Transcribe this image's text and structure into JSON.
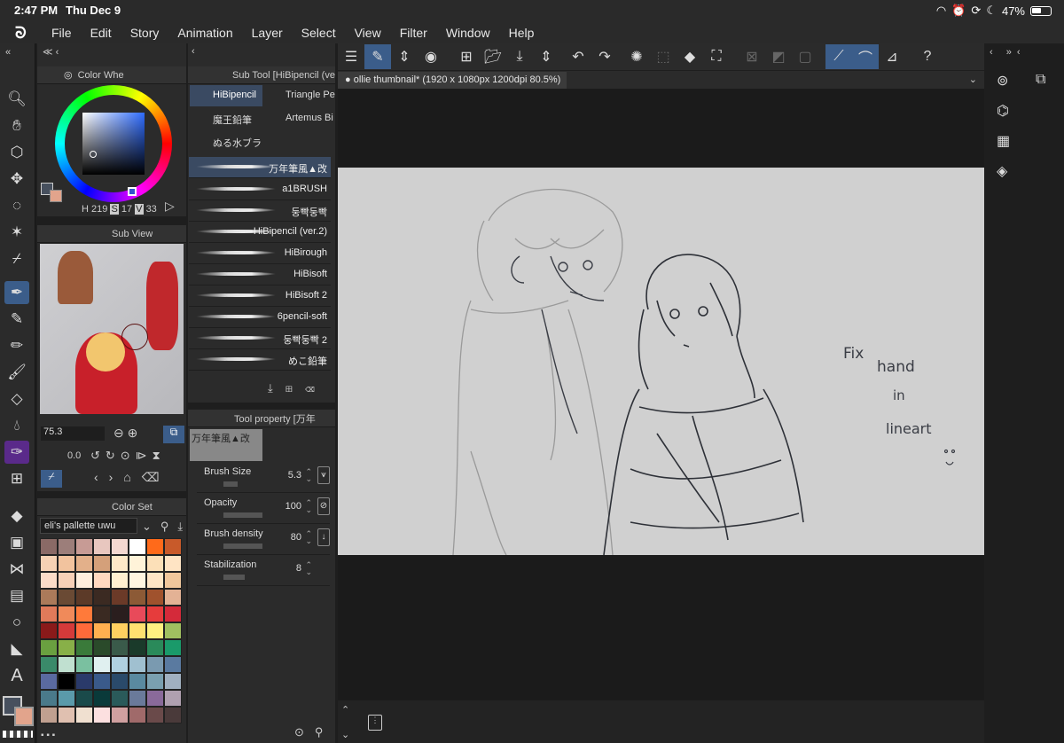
{
  "status": {
    "time": "2:47 PM",
    "date": "Thu Dec 9",
    "battery": "47%"
  },
  "menu": [
    "File",
    "Edit",
    "Story",
    "Animation",
    "Layer",
    "Select",
    "View",
    "Filter",
    "Window",
    "Help"
  ],
  "color_wheel": {
    "title": "Color Whe",
    "h_label": "H",
    "h": "219",
    "s_label": "S",
    "s": "17",
    "v_label": "V",
    "v": "33",
    "main_color": "#47505e",
    "sub_color": "#e2a48c"
  },
  "subview": {
    "title": "Sub View",
    "zoom": "75.3",
    "angle": "0.0"
  },
  "color_set": {
    "title": "Color Set",
    "palette": "eli's pallette uwu",
    "swatches": [
      "#8a6a66",
      "#9c7e7a",
      "#c79b95",
      "#e8c7bf",
      "#f4d8d0",
      "#ffffff",
      "#ff6a1a",
      "#c85a2a",
      "#f6d2b4",
      "#f2c39e",
      "#e3b08a",
      "#d4a07a",
      "#ffe9c8",
      "#fff3d9",
      "#fce0b8",
      "#ffe4c4",
      "#fcdcc8",
      "#f7d0b7",
      "#ffeedd",
      "#ffd9c0",
      "#fff0d0",
      "#fff5e0",
      "#ffe6c6",
      "#f0c79c",
      "#ab7a5a",
      "#6a4a34",
      "#5c3a28",
      "#3b2a22",
      "#6b3a28",
      "#8c5a36",
      "#a0522d",
      "#e3b295",
      "#e07a5a",
      "#f08a5a",
      "#ff7a3a",
      "#3a2a22",
      "#2a1e1e",
      "#e84a5a",
      "#e63c3c",
      "#d42a3a",
      "#8a1a1a",
      "#d43a3a",
      "#ff6a3a",
      "#ffb050",
      "#ffd060",
      "#ffe070",
      "#fff080",
      "#a0c060",
      "#6aa040",
      "#88b048",
      "#3a7a3a",
      "#2a4a2a",
      "#3a5a4a",
      "#1a3a2a",
      "#2a8a5a",
      "#1a9a6a",
      "#3a8a6a",
      "#c0e0d0",
      "#7ac0a0",
      "#e0f0f0",
      "#b0d0e0",
      "#a0c0d0",
      "#7a9ab0",
      "#5a7aa0",
      "#5a6aa0",
      "#000000",
      "#2a3a6a",
      "#3a5a8a",
      "#2a4a6a",
      "#5a8aa0",
      "#7aa0b0",
      "#a0b0c0",
      "#4a7a8a",
      "#5a9aaa",
      "#1a4a4a",
      "#0a3a3a",
      "#2a5a5a",
      "#6a7a9a",
      "#8a6a9a",
      "#b0a0b0",
      "#c0a090",
      "#e0c0b0",
      "#f0e0d0",
      "#fce0e0",
      "#d0a0a0",
      "#a06a6a",
      "#6a4a4a",
      "#4a3a3a"
    ]
  },
  "subtool": {
    "title": "Sub Tool [HiBipencil (ver",
    "groups": [
      "HiBipencil",
      "Triangle Pe",
      "魔王鉛筆",
      "Artemus Bi",
      "ぬる水ブラ"
    ],
    "brushes": [
      "万年筆風▲改",
      "a1BRUSH",
      "둥빡둥빡",
      "HiBipencil (ver.2)",
      "HiBirough",
      "HiBisoft",
      "HiBisoft 2",
      "6pencil-soft",
      "둥빡둥빡 2",
      "めこ鉛筆"
    ]
  },
  "tool_property": {
    "title": "Tool property [万年",
    "brush_name": "万年筆風▲改",
    "rows": [
      {
        "label": "Brush Size",
        "value": "5.3"
      },
      {
        "label": "Opacity",
        "value": "100"
      },
      {
        "label": "Brush density",
        "value": "80"
      },
      {
        "label": "Stabilization",
        "value": "8"
      }
    ]
  },
  "document": {
    "tab": "ollie thumbnail* (1920 x 1080px 1200dpi 80.5%)"
  },
  "canvas_note": [
    "Fix",
    "hand",
    "in",
    "lineart"
  ],
  "icons": {
    "tools": [
      "zoom-icon",
      "hand-icon",
      "rotate-icon",
      "move-icon",
      "lasso-icon",
      "magic-wand-icon",
      "eyedropper-icon",
      "pen-icon",
      "marker-icon",
      "pencil-icon",
      "brush-icon",
      "eraser-icon",
      "blend-icon",
      "figure-icon",
      "fill-icon",
      "gradient-icon",
      "ruler-icon",
      "frame-icon",
      "shape-icon",
      "vector-icon",
      "text-icon"
    ]
  }
}
